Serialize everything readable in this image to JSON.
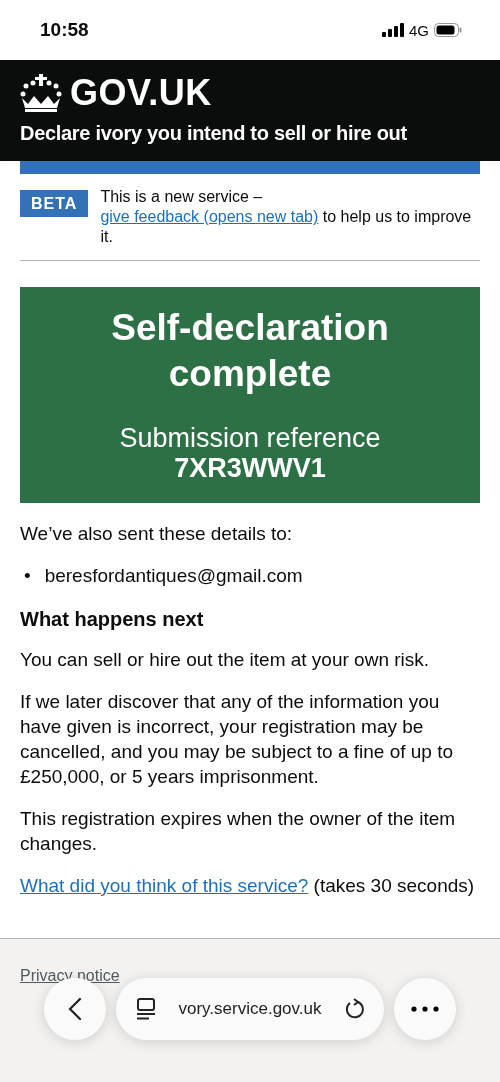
{
  "status_bar": {
    "time": "10:58",
    "network": "4G"
  },
  "header": {
    "logo": "GOV.UK",
    "service": "Declare ivory you intend to sell or hire out"
  },
  "phase_banner": {
    "tag": "BETA",
    "text_before": "This is a new service – ",
    "link": "give feedback (opens new tab)",
    "text_after": " to help us to improve it."
  },
  "panel": {
    "title": "Self-declaration complete",
    "reference_label": "Submission reference",
    "reference": "7XR3WWV1"
  },
  "sent_to": {
    "text": "We’ve also sent these details to:",
    "emails": [
      {
        "bullet": "•",
        "text": "beresfordantiques@gmail.com"
      }
    ]
  },
  "next": {
    "heading": "What happens next",
    "paragraphs": [
      "You can sell or hire out the item at your own risk.",
      "If we later discover that any of the information you have given is incorrect, your registration may be cancelled, and you may be subject to a fine of up to £250,000, or 5 years imprisonment.",
      "This registration expires when the owner of the item changes."
    ]
  },
  "feedback": {
    "link": "What did you think of this service?",
    "text": " (takes 30 seconds)"
  },
  "footer": {
    "links": [
      "Privacy notice"
    ]
  },
  "browser_bar": {
    "url": "vory.service.gov.uk"
  }
}
